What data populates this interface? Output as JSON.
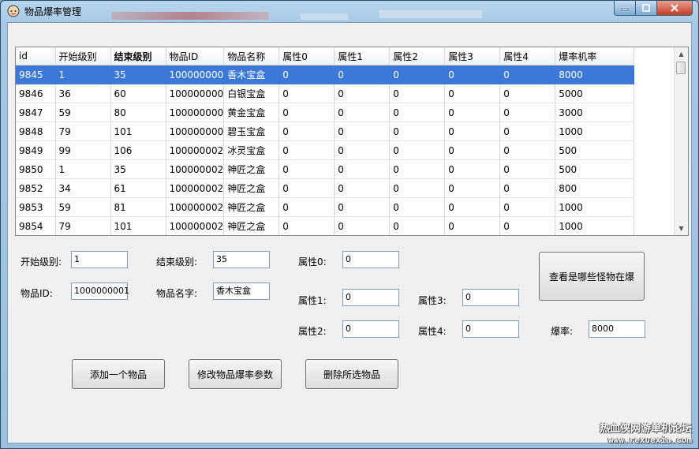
{
  "window": {
    "title": "物品爆率管理"
  },
  "grid": {
    "columns": [
      "id",
      "开始级别",
      "结束级别",
      "物品ID",
      "物品名称",
      "属性0",
      "属性1",
      "属性2",
      "属性3",
      "属性4",
      "爆率机率"
    ],
    "rows": [
      [
        "9845",
        "1",
        "35",
        "100000000",
        "香木宝盒",
        "0",
        "0",
        "0",
        "0",
        "0",
        "8000"
      ],
      [
        "9846",
        "36",
        "60",
        "100000000",
        "白银宝盒",
        "0",
        "0",
        "0",
        "0",
        "0",
        "5000"
      ],
      [
        "9847",
        "59",
        "80",
        "100000000",
        "黄金宝盒",
        "0",
        "0",
        "0",
        "0",
        "0",
        "3000"
      ],
      [
        "9848",
        "79",
        "101",
        "100000000",
        "碧玉宝盒",
        "0",
        "0",
        "0",
        "0",
        "0",
        "1000"
      ],
      [
        "9849",
        "99",
        "106",
        "100000002",
        "冰灵宝盒",
        "0",
        "0",
        "0",
        "0",
        "0",
        "500"
      ],
      [
        "9850",
        "1",
        "35",
        "100000002",
        "神匠之盒",
        "0",
        "0",
        "0",
        "0",
        "0",
        "500"
      ],
      [
        "9852",
        "34",
        "61",
        "100000002",
        "神匠之盒",
        "0",
        "0",
        "0",
        "0",
        "0",
        "800"
      ],
      [
        "9853",
        "59",
        "81",
        "100000002",
        "神匠之盒",
        "0",
        "0",
        "0",
        "0",
        "0",
        "1000"
      ],
      [
        "9854",
        "79",
        "101",
        "100000002",
        "神匠之盒",
        "0",
        "0",
        "0",
        "0",
        "0",
        "1000"
      ]
    ],
    "selected_row": 0
  },
  "form": {
    "start_level_label": "开始级别:",
    "start_level_value": "1",
    "end_level_label": "结束级别:",
    "end_level_value": "35",
    "item_id_label": "物品ID:",
    "item_id_value": "1000000001",
    "item_name_label": "物品名字:",
    "item_name_value": "香木宝盒",
    "attr0_label": "属性0:",
    "attr0_value": "0",
    "attr1_label": "属性1:",
    "attr1_value": "0",
    "attr2_label": "属性2:",
    "attr2_value": "0",
    "attr3_label": "属性3:",
    "attr3_value": "0",
    "attr4_label": "属性4:",
    "attr4_value": "0",
    "rate_label": "爆率:",
    "rate_value": "8000"
  },
  "buttons": {
    "which_monsters": "查看是哪些怪物在爆",
    "add_item": "添加一个物品",
    "modify_rate": "修改物品爆率参数",
    "delete_item": "删除所选物品"
  },
  "watermark": {
    "text": "热血侠网游单机论坛",
    "url": "www.rexuexia.com"
  },
  "colors": {
    "selection": "#3b78d8",
    "title_bg": "#a7c8e4",
    "close_button": "#c43a22"
  }
}
